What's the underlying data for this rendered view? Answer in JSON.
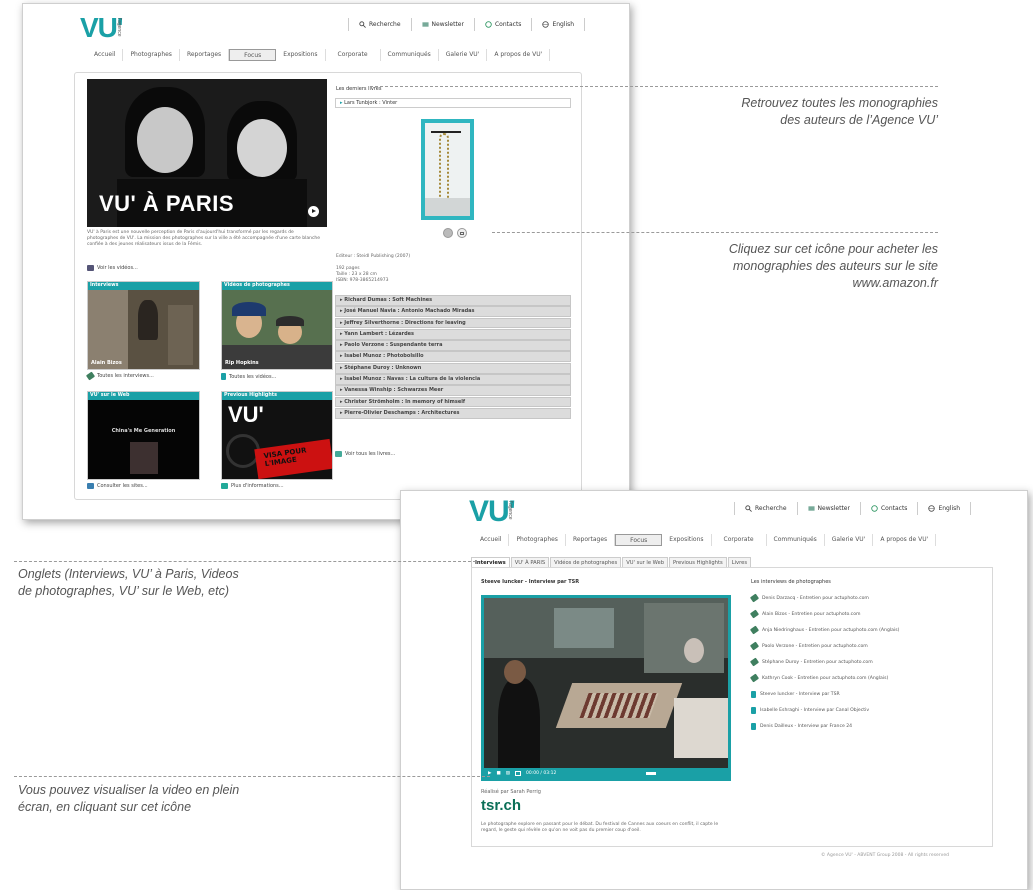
{
  "annotations": {
    "books": "Retrouvez toutes les monographies\ndes auteurs de l’Agence VU’",
    "amazon": "Cliquez sur cet icône pour acheter les\nmonographies des auteurs sur le site\nwww.amazon.fr",
    "tabs": "Onglets (Interviews, VU’ à Paris, Videos\nde photographes, VU’ sur le Web, etc)",
    "fullscreen": "Vous pouvez visualiser la video en plein\nécran, en cliquant sur cet icône"
  },
  "site": {
    "logo": "VU'",
    "logo_sub": "l'agence",
    "top_links": [
      {
        "label": "Recherche",
        "icon": "search-icon"
      },
      {
        "label": "Newsletter",
        "icon": "newsletter-icon"
      },
      {
        "label": "Contacts",
        "icon": "contact-icon"
      },
      {
        "label": "English",
        "icon": "globe-icon"
      }
    ],
    "menu": [
      "Accueil",
      "Photographes",
      "Reportages",
      "Focus",
      "Expositions",
      "Corporate",
      "Communiqués",
      "Galerie VU'",
      "A propos de VU'"
    ],
    "active_menu": "Focus",
    "accent_color": "#1aa0a6"
  },
  "shot1": {
    "hero_title": "VU' À PARIS",
    "hero_desc": "VU' à Paris est une nouvelle perception de Paris d'aujourd'hui transformé par les regards de photographes de VU'. La mission des photographes sur la ville a été accompagnée d'une carte blanche confiée à des jeunes réalisateurs issus de la Fémis.",
    "see_videos": "Voir les vidéos...",
    "boxes": [
      {
        "title": "Interviews",
        "caption": "Alain Bizos",
        "link": "Toutes les interviews..."
      },
      {
        "title": "Vidéos de photographes",
        "caption": "Rip Hopkins",
        "link": "Toutes les vidéos..."
      },
      {
        "title": "VU' sur le Web",
        "caption": "China's Me Generation",
        "link": "Consulter les sites..."
      },
      {
        "title": "Previous Highlights",
        "caption": "VISA POUR L'IMAGE",
        "link": "Plus d'informations..."
      }
    ],
    "books_title": "Les derniers livres",
    "book_current": "Lars Tunbjork : Vinter",
    "book_meta": "Editeur : Steidl Publishing (2007)",
    "book_meta2": "192 pages\nTaille : 23 x 28 cm\nISBN: 978-3865214973",
    "books": [
      "Richard Dumas : Soft Machines",
      "José Manuel Navia : Antonio Machado Miradas",
      "Jeffrey Silverthorne : Directions for leaving",
      "Yann Lambert : Lézardes",
      "Paolo Verzone : Suspendante terra",
      "Isabel Munoz : Photobolsillo",
      "Stéphane Duroy : Unknown",
      "Isabel Munoz : Navas : La cultura de la violencia",
      "Vanessa Winship : Schwarzes Meer",
      "Christer Strömholm : In memory of himself",
      "Pierre-Olivier Deschamps : Architectures"
    ],
    "see_books": "Voir tous les livres..."
  },
  "shot2": {
    "tabs": [
      "Interviews",
      "VU' À PARIS",
      "Vidéos de photographes",
      "VU' sur le Web",
      "Previous Highlights",
      "Livres"
    ],
    "active_tab": "Interviews",
    "video_title": "Steeve Iuncker - Interview par TSR",
    "video_time": "00:00 / 03:12",
    "realise": "Réalisé par Sarah Perrig",
    "tsr": "tsr.ch",
    "desc": "Le photographe explore en passant pour le débat. Du festival de Cannes aux coeurs en conflit, il capte le regard, le geste qui révèle ce qu'on ne voit pas du premier coup d'oeil.",
    "list_title": "Les interviews de photographes",
    "list": [
      {
        "label": "Denis Darzacq - Entretien pour actuphoto.com",
        "icon": "mic-icon"
      },
      {
        "label": "Alain Bizos - Entretien pour actuphoto.com",
        "icon": "mic-icon"
      },
      {
        "label": "Anja Niedringhaus - Entretien pour actuphoto.com (Anglais)",
        "icon": "mic-icon"
      },
      {
        "label": "Paolo Verzone - Entretien pour actuphoto.com",
        "icon": "mic-icon"
      },
      {
        "label": "Stéphane Duroy - Entretien pour actuphoto.com",
        "icon": "mic-icon"
      },
      {
        "label": "Kathryn Cook - Entretien pour actuphoto.com (Anglais)",
        "icon": "mic-icon"
      },
      {
        "label": "Steeve Iuncker - Interview par TSR",
        "icon": "tv-icon"
      },
      {
        "label": "Isabelle Eshraghi - Interview par Canal Objectiv",
        "icon": "tv-icon"
      },
      {
        "label": "Denis Dailleux - Interview par France 24",
        "icon": "tv-icon"
      }
    ],
    "footer": "© Agence VU' - ABVENT Group 2008 - All rights reserved"
  }
}
